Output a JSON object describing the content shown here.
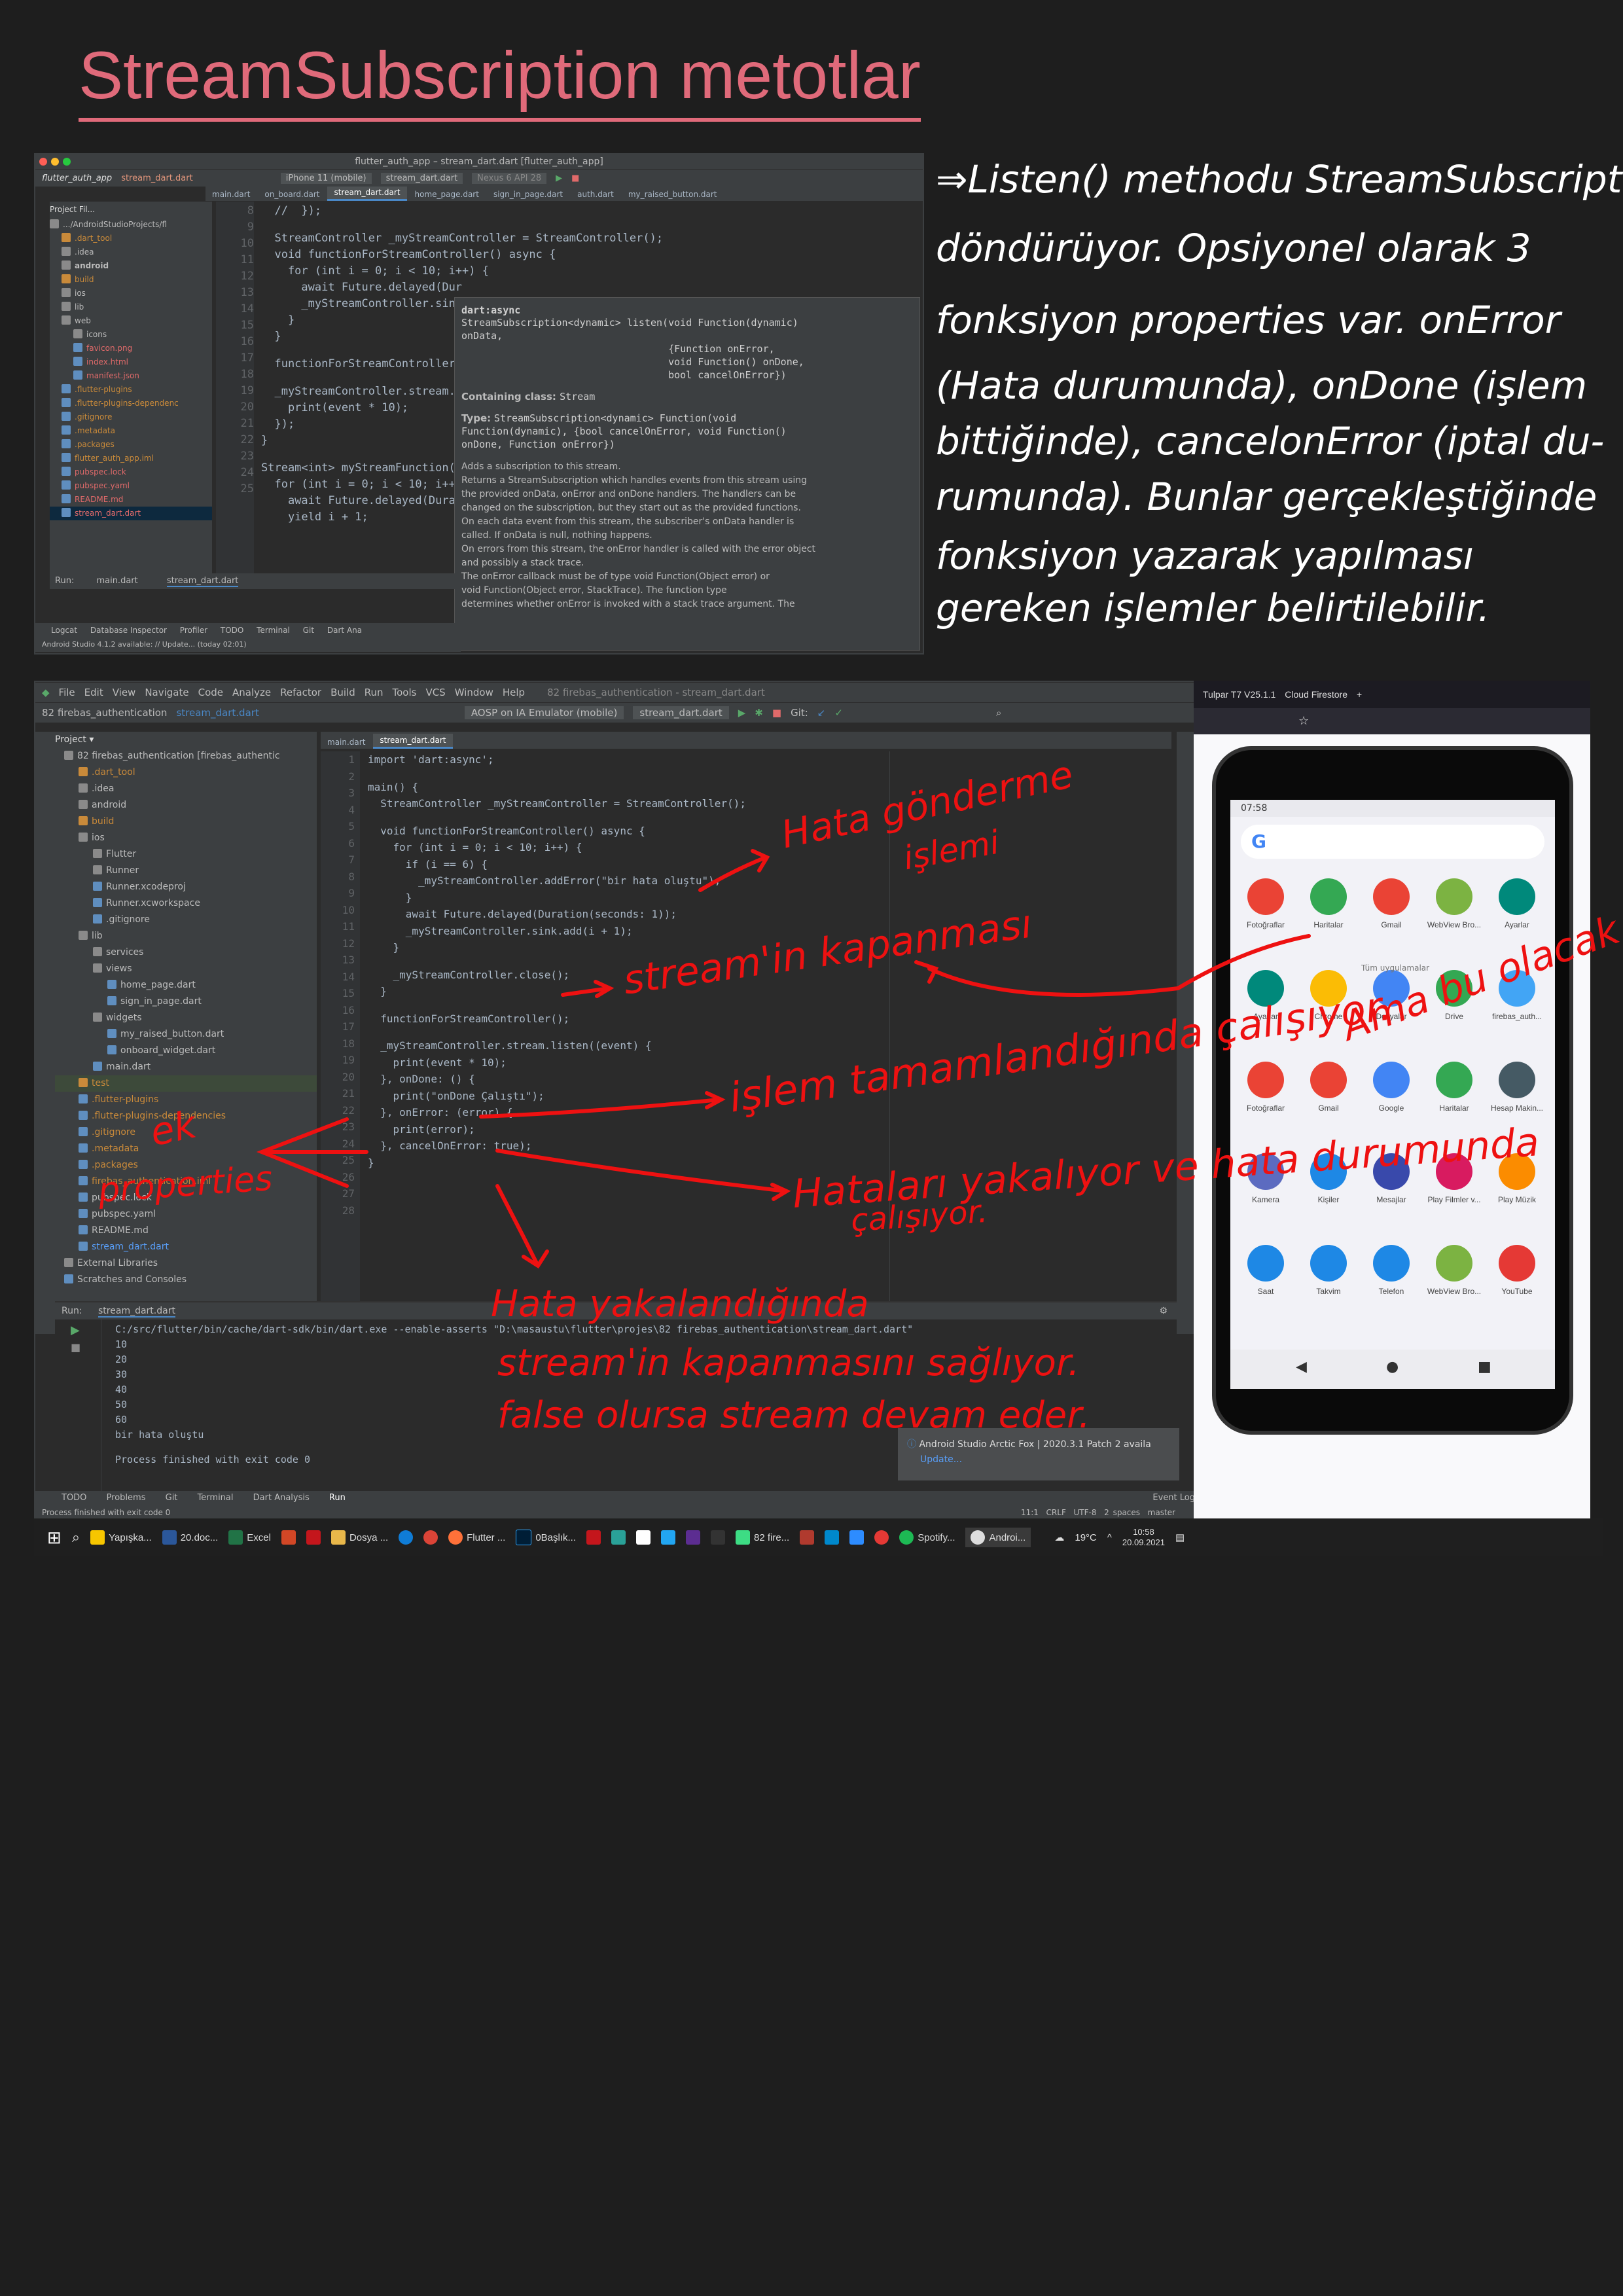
{
  "page_title": "StreamSubscription metotlar",
  "notes": [
    "⇒Listen() methodu StreamSubscription",
    "döndürüyor. Opsiyonel olarak 3",
    "fonksiyon properties var. onError",
    "(Hata durumunda), onDone (işlem",
    "bittiğinde), cancelonError (iptal du-",
    "rumunda). Bunlar gerçekleştiğinde",
    "fonksiyon yazarak yapılması",
    "gereken işlemler belirtilebilir."
  ],
  "ide1": {
    "window_title": "flutter_auth_app – stream_dart.dart [flutter_auth_app]",
    "breadcrumb": [
      "flutter_auth_app",
      "stream_dart.dart"
    ],
    "device": "iPhone 11 (mobile)",
    "run_config": "stream_dart.dart",
    "emulator": "Nexus 6 API 28",
    "tabs": [
      "main.dart",
      "on_board.dart",
      "stream_dart.dart",
      "home_page.dart",
      "sign_in_page.dart",
      "auth.dart",
      "my_raised_button.dart"
    ],
    "project_label": "Project Fil...",
    "tree": [
      ".../AndroidStudioProjects/fl",
      ".dart_tool",
      ".idea",
      "android",
      "build",
      "ios",
      "lib",
      "web",
      "icons",
      "favicon.png",
      "index.html",
      "manifest.json",
      ".flutter-plugins",
      ".flutter-plugins-dependenc",
      ".gitignore",
      ".metadata",
      ".packages",
      "flutter_auth_app.iml",
      "pubspec.lock",
      "pubspec.yaml",
      "README.md",
      "stream_dart.dart"
    ],
    "line_numbers": [
      "8",
      "9",
      "10",
      "11",
      "12",
      "13",
      "14",
      "15",
      "16",
      "17",
      "18",
      "19",
      "20",
      "21",
      "22",
      "23",
      "24",
      "25"
    ],
    "code": [
      "  //  });",
      "",
      "  StreamController _myStreamController = StreamController();",
      "  void functionForStreamController() async {",
      "    for (int i = 0; i < 10; i++) {",
      "      await Future.delayed(Dur",
      "      _myStreamController.sin",
      "    }",
      "  }",
      "",
      "  functionForStreamController",
      "",
      "  _myStreamController.stream.",
      "    print(event * 10);",
      "  });",
      "}",
      "",
      "Stream<int> myStreamFunction(",
      "  for (int i = 0; i < 10; i++",
      "    await Future.delayed(Dura",
      "    yield i + 1;"
    ],
    "popup": {
      "header": "dart:async",
      "signature": "StreamSubscription<dynamic> listen(void Function(dynamic)\nonData,\n                                   {Function onError,\n                                   void Function() onDone,\n                                   bool cancelOnError})",
      "containing_label": "Containing class:",
      "containing_value": "Stream",
      "type_label": "Type:",
      "type_value": "StreamSubscription<dynamic> Function(void\nFunction(dynamic), {bool cancelOnError, void Function()\nonDone, Function onError})",
      "desc": [
        "Adds a subscription to this stream.",
        "Returns a StreamSubscription which handles events from this stream using",
        "the provided onData, onError and onDone handlers. The handlers can be",
        "changed on the subscription, but they start out as the provided functions.",
        "On each data event from this stream, the subscriber's onData handler is",
        "called. If onData is null, nothing happens.",
        "On errors from this stream, the onError handler is called with the error object",
        "and possibly a stack trace.",
        "The onError callback must be of type void Function(Object error) or",
        "void Function(Object error, StackTrace). The function type",
        "determines whether onError is invoked with a stack trace argument. The"
      ]
    },
    "run_label": "Run:",
    "run_tabs": [
      "main.dart",
      "stream_dart.dart"
    ],
    "bottom_tools": [
      "Logcat",
      "Database Inspector",
      "Profiler",
      "TODO",
      "Terminal",
      "Git",
      "Dart Ana"
    ],
    "status": "Android Studio 4.1.2 available: // Update... (today 02:01)"
  },
  "ide2": {
    "menu": [
      "File",
      "Edit",
      "View",
      "Navigate",
      "Code",
      "Analyze",
      "Refactor",
      "Build",
      "Run",
      "Tools",
      "VCS",
      "Window",
      "Help"
    ],
    "window_title": "82 firebas_authentication - stream_dart.dart",
    "breadcrumb": [
      "82 firebas_authentication",
      "stream_dart.dart"
    ],
    "device": "AOSP on IA Emulator (mobile)",
    "run_config": "stream_dart.dart",
    "git_label": "Git:",
    "project_label": "Project",
    "tabs": [
      "main.dart",
      "stream_dart.dart"
    ],
    "tree": [
      "82 firebas_authentication [firebas_authentic",
      ".dart_tool",
      ".idea",
      "android",
      "build",
      "ios",
      "Flutter",
      "Runner",
      "Runner.xcodeproj",
      "Runner.xcworkspace",
      ".gitignore",
      "lib",
      "services",
      "views",
      "home_page.dart",
      "sign_in_page.dart",
      "widgets",
      "my_raised_button.dart",
      "onboard_widget.dart",
      "main.dart",
      "test",
      ".flutter-plugins",
      ".flutter-plugins-dependencies",
      ".gitignore",
      ".metadata",
      ".packages",
      "firebas_authentication.iml",
      "pubspec.lock",
      "pubspec.yaml",
      "README.md",
      "stream_dart.dart",
      "External Libraries",
      "Scratches and Consoles"
    ],
    "line_numbers": [
      "1",
      "2",
      "3",
      "4",
      "5",
      "6",
      "7",
      "8",
      "9",
      "10",
      "11",
      "12",
      "13",
      "14",
      "15",
      "16",
      "17",
      "18",
      "19",
      "20",
      "21",
      "22",
      "23",
      "24",
      "25",
      "26",
      "27",
      "28"
    ],
    "code": [
      "import 'dart:async';",
      "",
      "main() {",
      "  StreamController _myStreamController = StreamController();",
      "",
      "  void functionForStreamController() async {",
      "    for (int i = 0; i < 10; i++) {",
      "      if (i == 6) {",
      "        _myStreamController.addError(\"bir hata oluştu\");",
      "      }",
      "      await Future.delayed(Duration(seconds: 1));",
      "      _myStreamController.sink.add(i + 1);",
      "    }",
      "",
      "    _myStreamController.close();",
      "  }",
      "",
      "  functionForStreamController();",
      "",
      "  _myStreamController.stream.listen((event) {",
      "    print(event * 10);",
      "  }, onDone: () {",
      "    print(\"onDone Çalıştı\");",
      "  }, onError: (error) {",
      "    print(error);",
      "  }, cancelOnError: true);",
      "}",
      ""
    ],
    "run_label": "Run:",
    "run_tab": "stream_dart.dart",
    "console": [
      "C:/src/flutter/bin/cache/dart-sdk/bin/dart.exe --enable-asserts \"D:\\masaustu\\flutter\\projes\\82 firebas_authentication\\stream_dart.dart\"",
      "10",
      "20",
      "30",
      "40",
      "50",
      "60",
      "bir hata oluştu",
      "",
      "Process finished with exit code 0"
    ],
    "notification_title": "Android Studio Arctic Fox | 2020.3.1 Patch 2 availa",
    "notification_link": "Update...",
    "bottom_tools": [
      "TODO",
      "Problems",
      "Git",
      "Terminal",
      "Dart Analysis",
      "Run"
    ],
    "event_log": "Event Log",
    "status_left": "Process finished with exit code 0",
    "status_right": [
      "11:1",
      "CRLF",
      "UTF-8",
      "2 spaces",
      "master"
    ]
  },
  "browser": {
    "tabs": [
      "Tulpar T7 V25.1.1",
      "Cloud Firestore"
    ],
    "new_tab": "+"
  },
  "phone": {
    "time": "07:58",
    "apps": [
      {
        "label": "Fotoğraflar",
        "color": "#ea4335"
      },
      {
        "label": "Haritalar",
        "color": "#34a853"
      },
      {
        "label": "Gmail",
        "color": "#ea4335"
      },
      {
        "label": "WebView Bro...",
        "color": "#7cb342"
      },
      {
        "label": "Ayarlar",
        "color": "#00897b"
      },
      {
        "label": "Ayarlar",
        "color": "#00897b"
      },
      {
        "label": "Chrome",
        "color": "#fbbc05"
      },
      {
        "label": "Dosyalar",
        "color": "#4285f4"
      },
      {
        "label": "Drive",
        "color": "#34a853"
      },
      {
        "label": "firebas_auth...",
        "color": "#42a5f5"
      },
      {
        "label": "Fotoğraflar",
        "color": "#ea4335"
      },
      {
        "label": "Gmail",
        "color": "#ea4335"
      },
      {
        "label": "Google",
        "color": "#4285f4"
      },
      {
        "label": "Haritalar",
        "color": "#34a853"
      },
      {
        "label": "Hesap Makin...",
        "color": "#455a64"
      },
      {
        "label": "Kamera",
        "color": "#5c6bc0"
      },
      {
        "label": "Kişiler",
        "color": "#1e88e5"
      },
      {
        "label": "Mesajlar",
        "color": "#3949ab"
      },
      {
        "label": "Play Filmler v...",
        "color": "#d81b60"
      },
      {
        "label": "Play Müzik",
        "color": "#fb8c00"
      },
      {
        "label": "Saat",
        "color": "#1e88e5"
      },
      {
        "label": "Takvim",
        "color": "#1e88e5"
      },
      {
        "label": "Telefon",
        "color": "#1e88e5"
      },
      {
        "label": "WebView Bro...",
        "color": "#7cb342"
      },
      {
        "label": "YouTube",
        "color": "#e53935"
      }
    ],
    "suggested": "Tüm uygulamalar"
  },
  "annotations": {
    "a1": "Hata gönderme",
    "a1b": "işlemi",
    "a2": "stream'in kapanması",
    "a3": "Ama bu olacak",
    "a4": "işlem tamamlandığında çalışıyor.",
    "a5": "ek",
    "a6": "properties",
    "a7": "Hataları yakalıyor ve hata durumunda",
    "a7b": "çalışıyor.",
    "a8": "Hata yakalandığında",
    "a9": "stream'in kapanmasını sağlıyor.",
    "a10": "false olursa stream devam eder."
  },
  "taskbar": {
    "items": [
      "Yapışka...",
      "20.doc...",
      "Excel",
      "Dosya ...",
      "Flutter ...",
      "0Başlık...",
      "82 fire...",
      "Spotify...",
      "Androi..."
    ],
    "weather": "19°C",
    "time": "10:58",
    "date": "20.09.2021"
  },
  "colors": {
    "title": "#e06a7a",
    "annotation": "#ee1111",
    "ide_bg": "#2b2b2b",
    "ide_panel": "#3c3f41"
  }
}
